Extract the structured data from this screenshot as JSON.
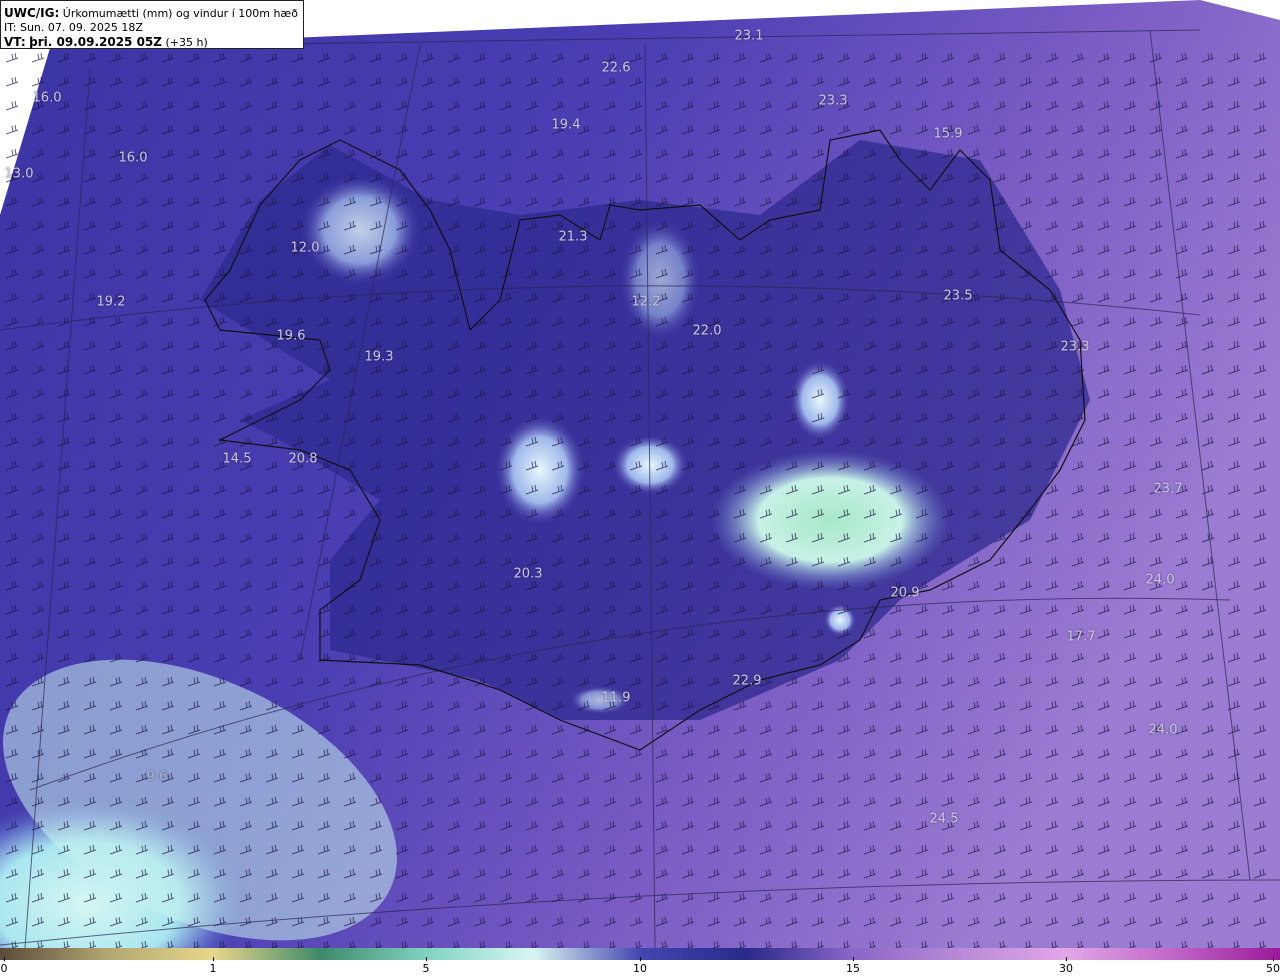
{
  "header": {
    "source": "UWC/IG:",
    "title": "Úrkomumætti (mm) og vindur í 100m hæð",
    "it_line": "IT: Sun. 07. 09. 2025 18Z",
    "vt_label": "VT:",
    "vt_value": "þri. 09.09.2025 05Z",
    "lead": "(+35 h)"
  },
  "map_values": [
    {
      "text": "23.1"
    },
    {
      "text": "22.6"
    },
    {
      "text": "16.0"
    },
    {
      "text": "23.3"
    },
    {
      "text": "19.4"
    },
    {
      "text": "16.0"
    },
    {
      "text": "15.9"
    },
    {
      "text": "13.0"
    },
    {
      "text": "21.3"
    },
    {
      "text": "12.0"
    },
    {
      "text": "19.2"
    },
    {
      "text": "12.2"
    },
    {
      "text": "23.5"
    },
    {
      "text": "22.0"
    },
    {
      "text": "19.6"
    },
    {
      "text": "19.3"
    },
    {
      "text": "23.3"
    },
    {
      "text": "14.5"
    },
    {
      "text": "20.8"
    },
    {
      "text": "23.7"
    },
    {
      "text": "20.3"
    },
    {
      "text": "24.0"
    },
    {
      "text": "20.9"
    },
    {
      "text": "17.7"
    },
    {
      "text": "22.9"
    },
    {
      "text": "11.9"
    },
    {
      "text": "24.0"
    },
    {
      "text": "9.6"
    },
    {
      "text": "24.5"
    }
  ],
  "colorbar": {
    "ticks": [
      "0",
      "1",
      "5",
      "10",
      "15",
      "30",
      "50"
    ],
    "colors": [
      "#5c4a3a",
      "#b0a670",
      "#e8d78a",
      "#3d8a6a",
      "#7fd3c0",
      "#d8f6f2",
      "#4446b0",
      "#2a2a8a",
      "#8a66c8",
      "#b88ad8",
      "#e2a6e6",
      "#c066c8",
      "#9a1a9a"
    ]
  },
  "colors": {
    "background": "#4a3fae",
    "high_precip": "#c9f4ee",
    "wind_barb": "#1a1440"
  }
}
